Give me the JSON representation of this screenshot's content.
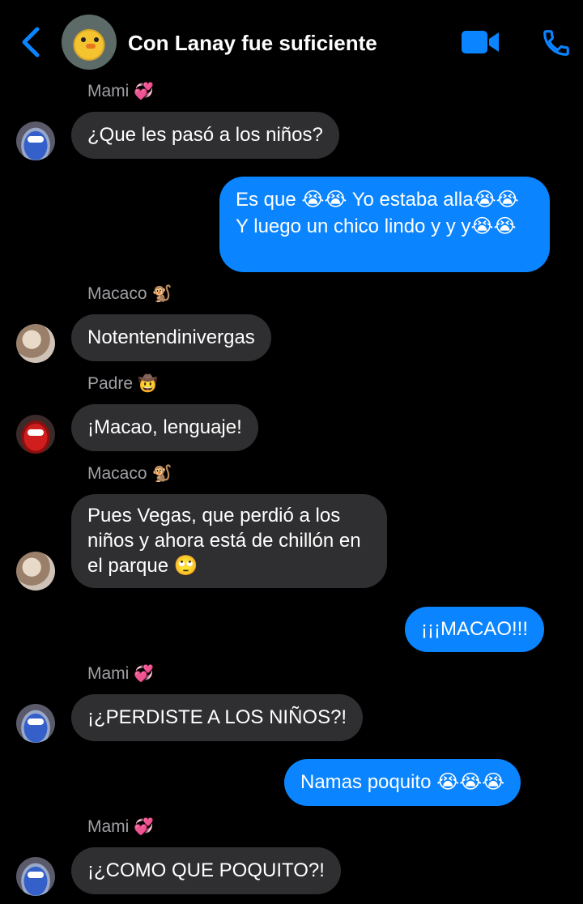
{
  "header": {
    "title": "Con Lanay fue suficiente",
    "accent": "#0a84ff"
  },
  "messages": [
    {
      "sender": "Mami",
      "sender_emoji": "💞",
      "text": "¿Que les pasó a los niños?"
    },
    {
      "text": "Es que 😭😭 Yo estaba alla😭😭 Y luego un chico lindo y y y😭😭"
    },
    {
      "sender": "Macaco",
      "sender_emoji": "🐒",
      "text": "Notentendinivergas"
    },
    {
      "sender": "Padre",
      "sender_emoji": "🤠",
      "text": "¡Macao, lenguaje!"
    },
    {
      "sender": "Macaco",
      "sender_emoji": "🐒",
      "text": "Pues Vegas, que perdió a los niños y ahora está de chillón en el parque 🙄"
    },
    {
      "text": "¡¡¡MACAO!!!"
    },
    {
      "sender": "Mami",
      "sender_emoji": "💞",
      "text": "¡¿PERDISTE A LOS NIÑOS?!"
    },
    {
      "text": "Namas poquito 😭😭😭"
    },
    {
      "sender": "Mami",
      "sender_emoji": "💞",
      "text": "¡¿COMO QUE POQUITO?!"
    }
  ],
  "colors": {
    "incoming_bubble": "#2f2f31",
    "outgoing_bubble": "#0a84ff",
    "background": "#000000"
  }
}
